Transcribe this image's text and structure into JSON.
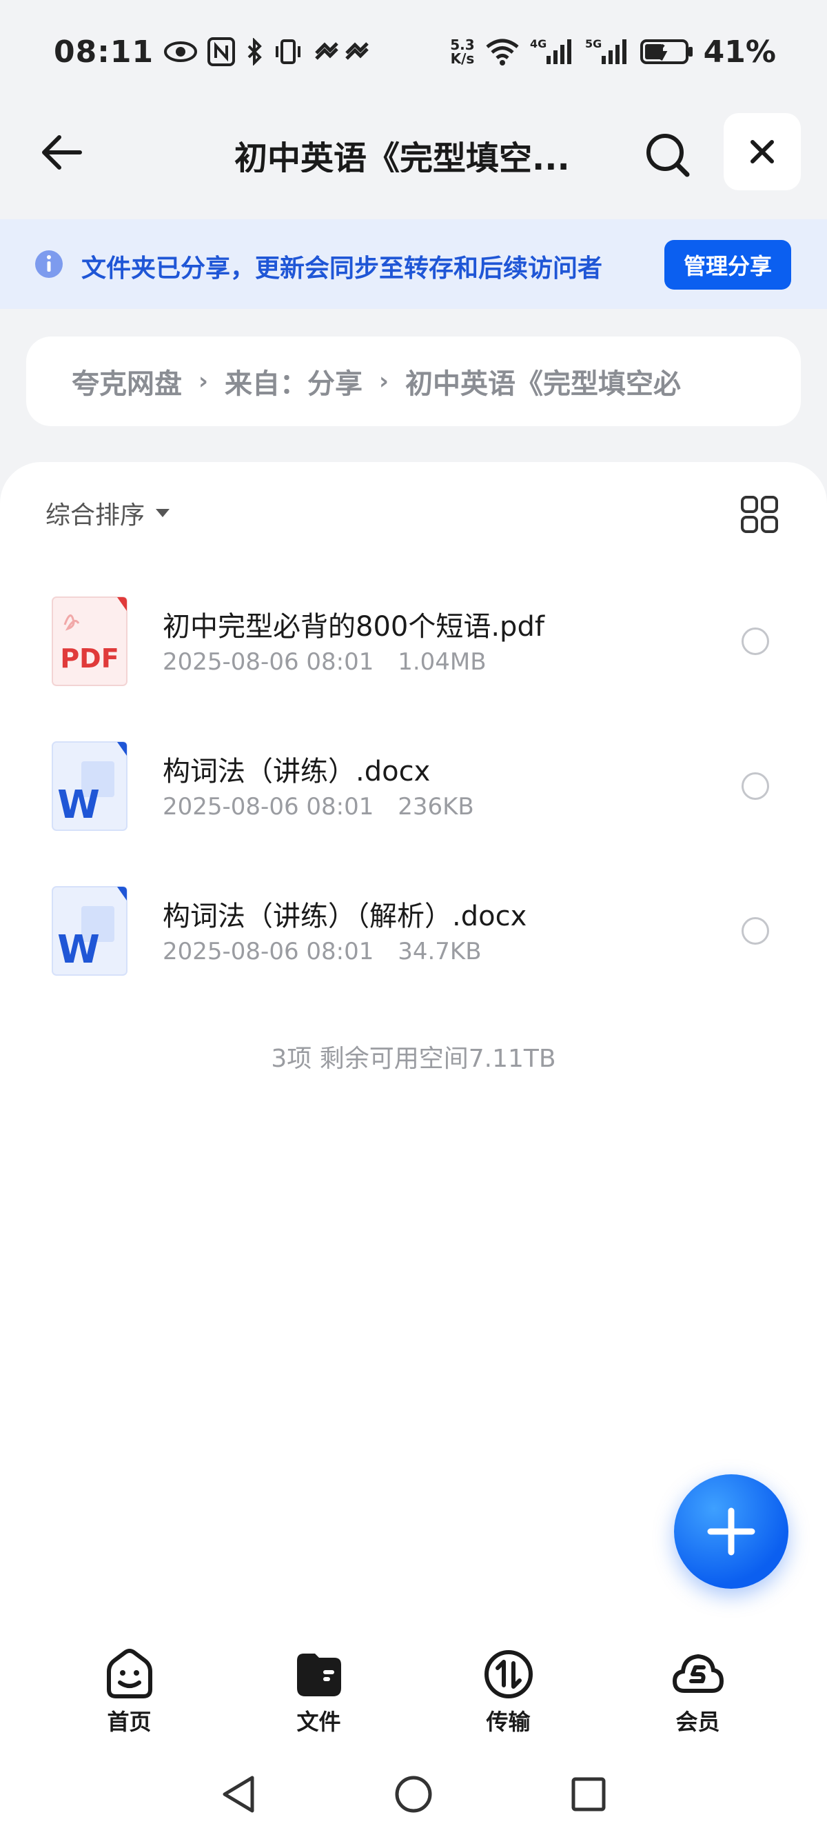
{
  "status_bar": {
    "time": "08:11",
    "net_speed_value": "5.3",
    "net_speed_unit": "K/s",
    "signal_1_label": "4G",
    "signal_2_label": "5G",
    "battery_percent": "41%",
    "icons": [
      "eye-icon",
      "nfc-icon",
      "bluetooth-icon",
      "vibrate-icon",
      "hotspot-icon",
      "wifi-icon",
      "signal-icon",
      "battery-icon"
    ]
  },
  "header": {
    "title": "初中英语《完型填空...",
    "back_icon": "arrow-left-icon",
    "search_icon": "search-icon",
    "close_icon": "close-icon"
  },
  "share_banner": {
    "text": "文件夹已分享，更新会同步至转存和后续访问者",
    "button_label": "管理分享",
    "accent": "#0b5ff0"
  },
  "breadcrumb": {
    "items": [
      "夸克网盘",
      "来自：分享",
      "初中英语《完型填空必"
    ],
    "separator": "›"
  },
  "toolbar": {
    "sort_label": "综合排序"
  },
  "files": [
    {
      "name": "初中完型必背的800个短语.pdf",
      "date": "2025-08-06 08:01",
      "size": "1.04MB",
      "type": "pdf",
      "icon_label": "PDF"
    },
    {
      "name": "构词法（讲练）.docx",
      "date": "2025-08-06 08:01",
      "size": "236KB",
      "type": "word",
      "icon_label": "W"
    },
    {
      "name": "构词法（讲练）（解析）.docx",
      "date": "2025-08-06 08:01",
      "size": "34.7KB",
      "type": "word",
      "icon_label": "W"
    }
  ],
  "summary": "3项 剩余可用空间7.11TB",
  "bottom_nav": [
    {
      "label": "首页",
      "icon": "smile-home-icon"
    },
    {
      "label": "文件",
      "icon": "folder-wallet-icon"
    },
    {
      "label": "传输",
      "icon": "transfer-icon"
    },
    {
      "label": "会员",
      "icon": "vip-cloud-icon"
    }
  ],
  "colors": {
    "pdf_red": "#e03a3a",
    "word_blue": "#1f56d6",
    "muted_text": "#9a9ca1"
  }
}
